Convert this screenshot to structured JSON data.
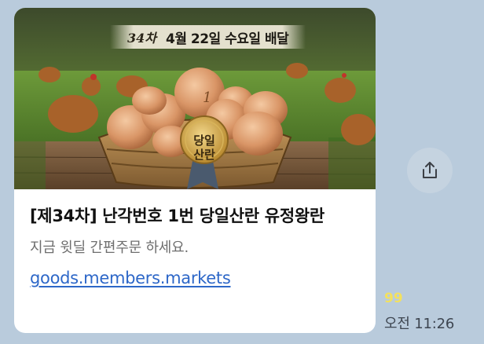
{
  "message": {
    "preview": {
      "banner_round": "34차",
      "banner_date": "4월 22일 수요일 배달",
      "egg_number": "1",
      "badge_label": "당일\n산란"
    },
    "title": "[제34차] 난각번호 1번 당일산란 유정왕란",
    "description": "지금 윗딜 간편주문 하세요.",
    "link_text": "goods.members.markets",
    "share_icon": "share-icon",
    "unread_count": "99",
    "timestamp": "오전 11:26"
  },
  "colors": {
    "background": "#b9cbdc",
    "card": "#ffffff",
    "link": "#2d67c8",
    "unread": "#f3e15e"
  }
}
